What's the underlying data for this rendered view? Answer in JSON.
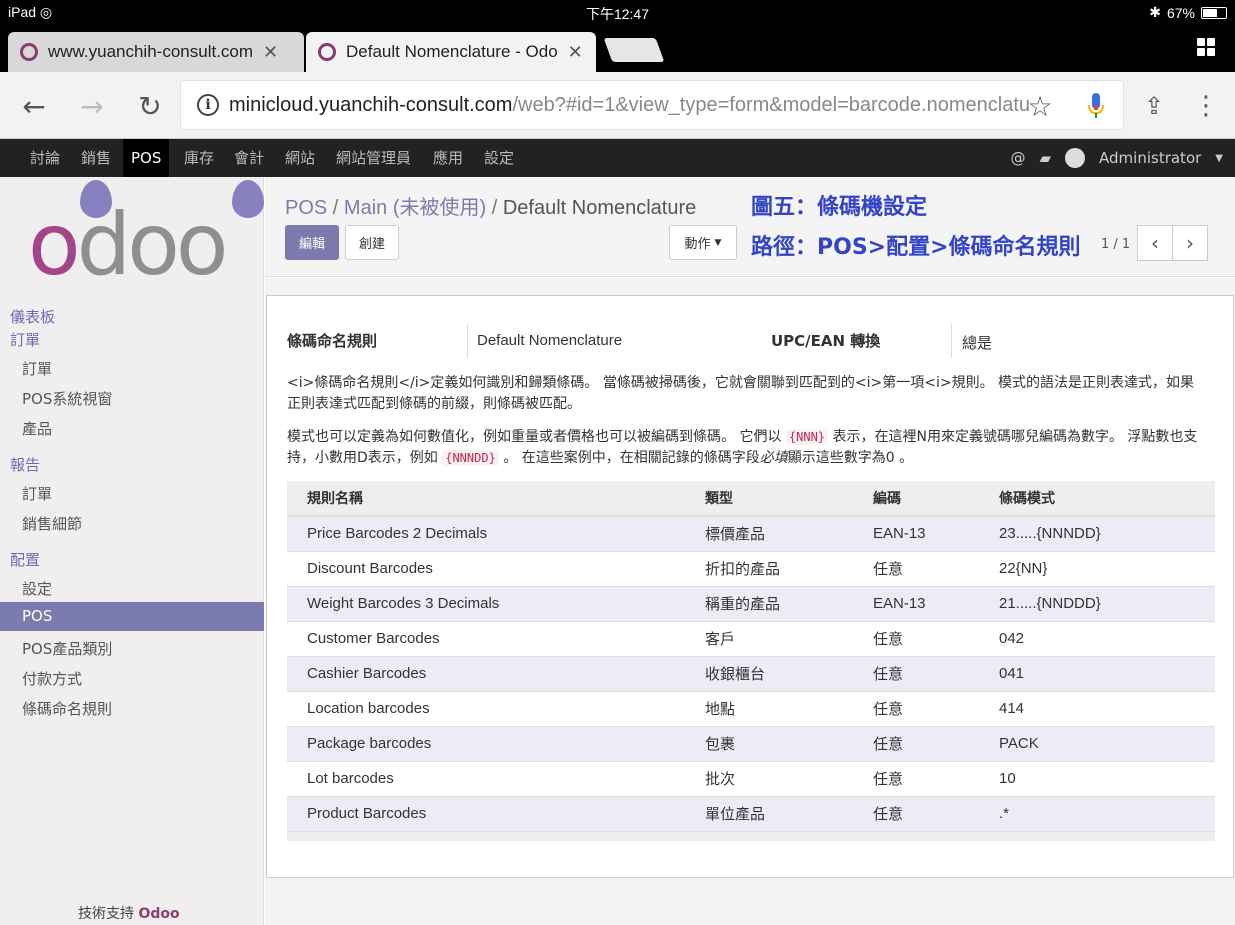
{
  "status_bar": {
    "device": "iPad",
    "time": "下午12:47",
    "battery": "67%",
    "battery_fraction": 0.67
  },
  "tabs": [
    {
      "label": "www.yuanchih-consult.com",
      "active": false
    },
    {
      "label": "Default Nomenclature - Odo",
      "active": true
    }
  ],
  "address_bar": {
    "host": "minicloud.yuanchih-consult.com",
    "path": "/web?#id=1&view_type=form&model=barcode.nomenclatu"
  },
  "top_menu": {
    "items": [
      "討論",
      "銷售",
      "POS",
      "庫存",
      "會計",
      "網站",
      "網站管理員",
      "應用",
      "設定"
    ],
    "active": "POS",
    "user": "Administrator"
  },
  "sidebar": {
    "logo": "odoo",
    "sections": [
      {
        "title": "儀表板",
        "items": []
      },
      {
        "title": "訂單",
        "items": [
          "訂單",
          "POS系統視窗",
          "產品"
        ]
      },
      {
        "title": "報告",
        "items": [
          "訂單",
          "銷售細節"
        ]
      },
      {
        "title": "配置",
        "items": [
          "設定",
          "POS",
          "POS產品類別",
          "付款方式",
          "條碼命名規則"
        ]
      }
    ],
    "active_item": "POS",
    "powered_prefix": "技術支持",
    "powered_brand": "Odoo"
  },
  "breadcrumb": {
    "items": [
      "POS",
      "Main (未被使用)"
    ],
    "current": "Default Nomenclature"
  },
  "annotations": {
    "line1": "圖五：條碼機設定",
    "line2": "路徑：POS>配置>條碼命名規則"
  },
  "buttons": {
    "edit": "編輯",
    "create": "創建",
    "action": "動作"
  },
  "pager": "1 / 1",
  "form": {
    "name_label": "條碼命名規則",
    "name_value": "Default Nomenclature",
    "upc_label": "UPC/EAN 轉換",
    "upc_value": "總是",
    "para1": "<i>條碼命名規則</i>定義如何識別和歸類條碼。 當條碼被掃碼後，它就會關聯到匹配到的<i>第一項<i>規則。 模式的語法是正則表達式，如果正則表達式匹配到條碼的前綴，則條碼被匹配。",
    "para2_a": "模式也可以定義為如何數值化，例如重量或者價格也可以被編碼到條碼。 它們以",
    "para2_code1": "{NNN}",
    "para2_b": "表示，在這裡N用來定義號碼哪兒編碼為數字。 浮點數也支持，小數用D表示，例如",
    "para2_code2": "{NNNDD}",
    "para2_c": "。 在這些案例中，在相關記錄的條碼字段",
    "para2_em": "必填",
    "para2_d": "顯示這些數字為0 。"
  },
  "table": {
    "headers": [
      "規則名稱",
      "類型",
      "編碼",
      "條碼模式"
    ],
    "rows": [
      [
        "Price Barcodes 2 Decimals",
        "標價產品",
        "EAN-13",
        "23.....{NNNDD}"
      ],
      [
        "Discount Barcodes",
        "折扣的產品",
        "任意",
        "22{NN}"
      ],
      [
        "Weight Barcodes 3 Decimals",
        "稱重的產品",
        "EAN-13",
        "21.....{NNDDD}"
      ],
      [
        "Customer Barcodes",
        "客戶",
        "任意",
        "042"
      ],
      [
        "Cashier Barcodes",
        "收銀櫃台",
        "任意",
        "041"
      ],
      [
        "Location barcodes",
        "地點",
        "任意",
        "414"
      ],
      [
        "Package barcodes",
        "包裹",
        "任意",
        "PACK"
      ],
      [
        "Lot barcodes",
        "批次",
        "任意",
        "10"
      ],
      [
        "Product Barcodes",
        "單位產品",
        "任意",
        ".*"
      ]
    ]
  },
  "colors": {
    "odoo_purple": "#7c7bad",
    "annotation_blue": "#3344c7",
    "odoo_brand": "#a24689"
  }
}
